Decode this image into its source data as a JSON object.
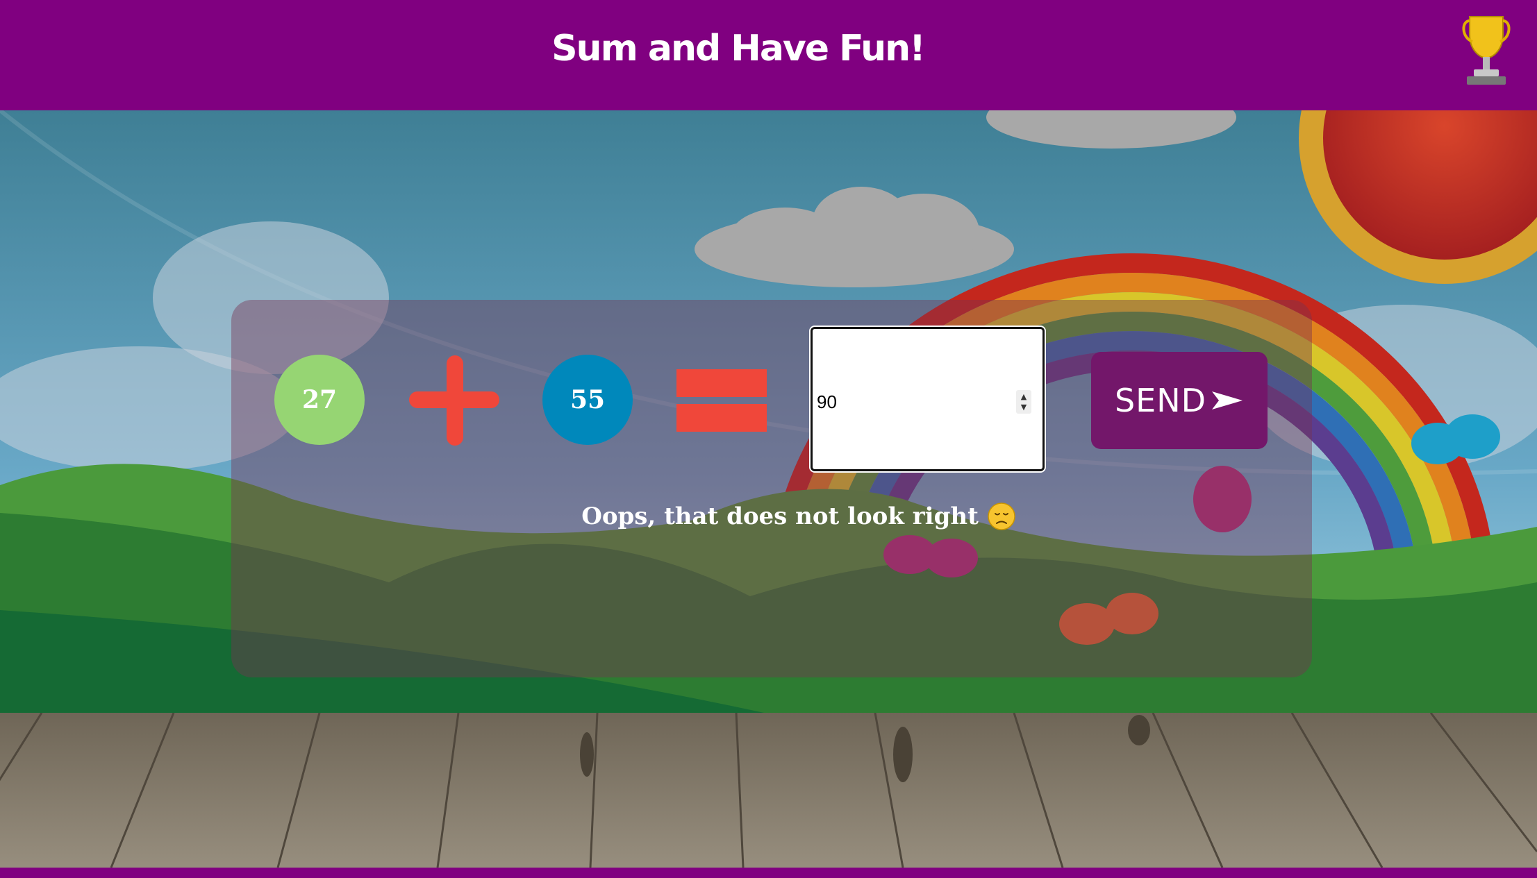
{
  "header": {
    "title": "Sum and Have Fun!",
    "trophy_icon": "trophy-icon"
  },
  "colors": {
    "brand_purple": "#800080",
    "send_button": "#73176a",
    "operand_a": "#96d573",
    "operand_b": "#0088bb",
    "operator": "#f0473a"
  },
  "equation": {
    "operand_a": "27",
    "operand_b": "55",
    "plus_icon": "plus-icon",
    "equals_icon": "equals-icon"
  },
  "answer": {
    "value": "90"
  },
  "send_button": {
    "label": "SEND",
    "icon": "arrow-right-icon"
  },
  "feedback": {
    "message": "Oops, that does not look right",
    "emoji": "sad-face-icon"
  }
}
